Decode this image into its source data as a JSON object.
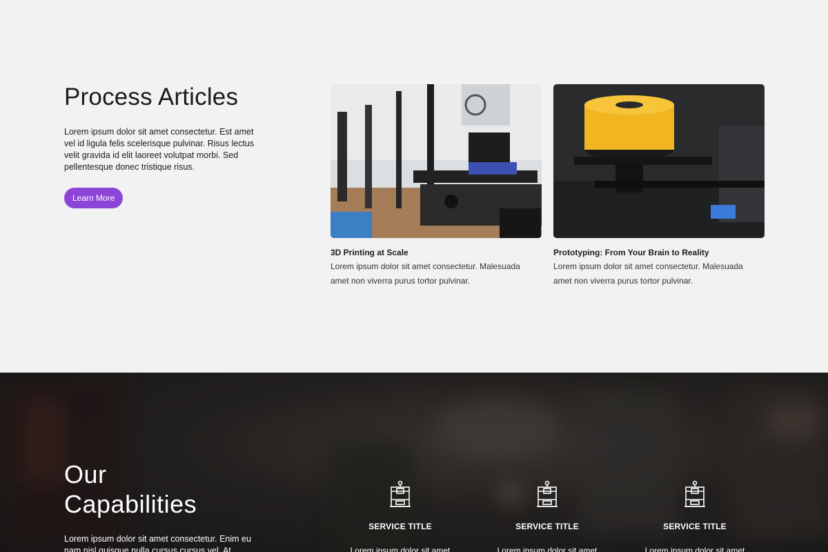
{
  "articles": {
    "title": "Process Articles",
    "description": "Lorem ipsum dolor sit amet consectetur. Est amet vel id ligula felis scelerisque pulvinar. Risus lectus velit gravida id elit laoreet volutpat morbi. Sed pellentesque donec tristique risus.",
    "button_label": "Learn More",
    "accent_color": "#8d45d8",
    "cards": [
      {
        "title": "3D Printing at Scale",
        "text": "Lorem ipsum dolor sit amet consectetur. Malesuada amet non viverra purus tortor pulvinar."
      },
      {
        "title": "Prototyping: From Your Brain to Reality",
        "text": "Lorem ipsum dolor sit amet consectetur. Malesuada amet non viverra purus tortor pulvinar."
      }
    ]
  },
  "capabilities": {
    "title_line1": "Our",
    "title_line2": "Capabilities",
    "description": "Lorem ipsum dolor sit amet consectetur. Enim eu nam nisl quisque nulla cursus cursus vel. At",
    "services": [
      {
        "icon": "3d-printer-icon",
        "title": "SERVICE TITLE",
        "text": "Lorem ipsum dolor sit amet"
      },
      {
        "icon": "3d-printer-icon",
        "title": "SERVICE TITLE",
        "text": "Lorem ipsum dolor sit amet"
      },
      {
        "icon": "3d-printer-icon",
        "title": "SERVICE TITLE",
        "text": "Lorem ipsum dolor sit amet"
      }
    ]
  }
}
